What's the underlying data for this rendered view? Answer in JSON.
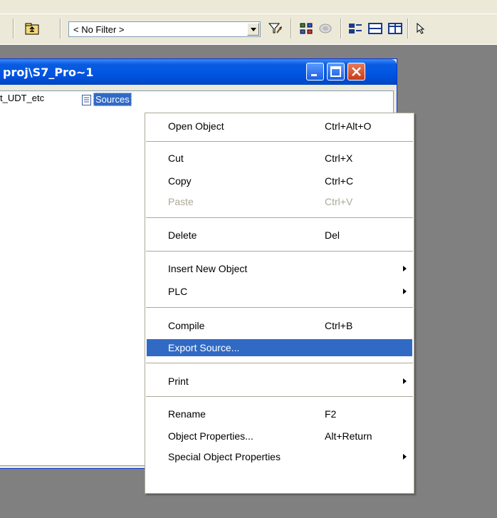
{
  "toolbar": {
    "filter_value": "< No Filter >",
    "icons": [
      "up-folder-icon",
      "dropdown-arrow-icon",
      "filter-icon",
      "network-icon",
      "simulation-icon",
      "large-icons-icon",
      "list-icon",
      "details-icon",
      "help-pointer-icon"
    ]
  },
  "window": {
    "title": "proj\\S7_Pro~1",
    "controls": [
      "minimize",
      "maximize",
      "close"
    ]
  },
  "pane": {
    "crumb": "t_UDT_etc",
    "selected_item": "Sources"
  },
  "context_menu": {
    "items": [
      {
        "label": "Open Object",
        "shortcut": "Ctrl+Alt+O"
      },
      {
        "label": "Cut",
        "shortcut": "Ctrl+X"
      },
      {
        "label": "Copy",
        "shortcut": "Ctrl+C"
      },
      {
        "label": "Paste",
        "shortcut": "Ctrl+V",
        "disabled": true
      },
      {
        "label": "Delete",
        "shortcut": "Del"
      },
      {
        "label": "Insert New Object",
        "submenu": true
      },
      {
        "label": "PLC",
        "submenu": true
      },
      {
        "label": "Compile",
        "shortcut": "Ctrl+B"
      },
      {
        "label": "Export Source...",
        "highlighted": true
      },
      {
        "label": "Print",
        "submenu": true
      },
      {
        "label": "Rename",
        "shortcut": "F2"
      },
      {
        "label": "Object Properties...",
        "shortcut": "Alt+Return"
      },
      {
        "label": "Special Object Properties",
        "submenu": true
      }
    ]
  },
  "colors": {
    "highlight": "#316ac5",
    "titlebar": "#0054e3",
    "menu_bg": "#ffffff",
    "desktop": "#808080",
    "toolbar_bg": "#ece9d8"
  }
}
